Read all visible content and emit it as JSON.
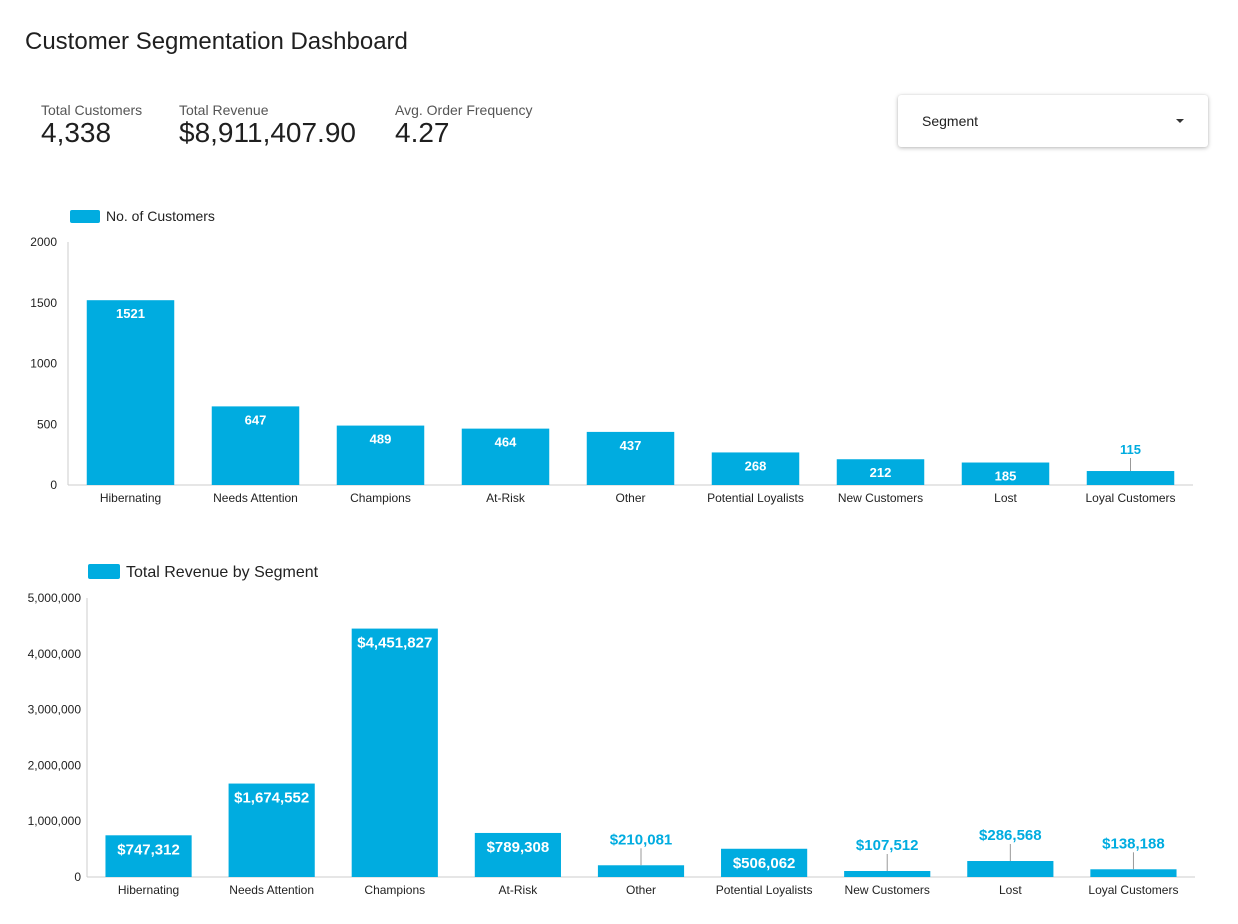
{
  "page": {
    "title": "Customer Segmentation Dashboard"
  },
  "kpis": [
    {
      "label": "Total Customers",
      "value": "4,338"
    },
    {
      "label": "Total Revenue",
      "value": "$8,911,407.90"
    },
    {
      "label": "Avg. Order Frequency",
      "value": "4.27"
    }
  ],
  "filter": {
    "label": "Segment"
  },
  "colors": {
    "bar": "#00ace0",
    "axis": "#cccccc",
    "label_inside": "#ffffff",
    "label_outside": "#00ace0"
  },
  "chart_data": [
    {
      "type": "bar",
      "categories": [
        "Hibernating",
        "Needs Attention",
        "Champions",
        "At-Risk",
        "Other",
        "Potential Loyalists",
        "New Customers",
        "Lost",
        "Loyal Customers"
      ],
      "series": [
        {
          "name": "No. of Customers",
          "values": [
            1521,
            647,
            489,
            464,
            437,
            268,
            212,
            185,
            115
          ]
        }
      ],
      "data_labels": [
        "1521",
        "647",
        "489",
        "464",
        "437",
        "268",
        "212",
        "185",
        "115"
      ],
      "ylim": [
        0,
        2000
      ],
      "yticks": [
        0,
        500,
        1000,
        1500,
        2000
      ],
      "ytick_labels": [
        "0",
        "500",
        "1000",
        "1500",
        "2000"
      ],
      "legend": "top-left",
      "grid": false
    },
    {
      "type": "bar",
      "categories": [
        "Hibernating",
        "Needs Attention",
        "Champions",
        "At-Risk",
        "Other",
        "Potential Loyalists",
        "New Customers",
        "Lost",
        "Loyal Customers"
      ],
      "series": [
        {
          "name": "Total Revenue by Segment",
          "values": [
            747312,
            1674552,
            4451827,
            789308,
            210081,
            506062,
            107512,
            286568,
            138188
          ]
        }
      ],
      "data_labels": [
        "$747,312",
        "$1,674,552",
        "$4,451,827",
        "$789,308",
        "$210,081",
        "$506,062",
        "$107,512",
        "$286,568",
        "$138,188"
      ],
      "ylim": [
        0,
        5000000
      ],
      "yticks": [
        0,
        1000000,
        2000000,
        3000000,
        4000000,
        5000000
      ],
      "ytick_labels": [
        "0",
        "1,000,000",
        "2,000,000",
        "3,000,000",
        "4,000,000",
        "5,000,000"
      ],
      "legend": "top-left",
      "grid": false
    }
  ]
}
